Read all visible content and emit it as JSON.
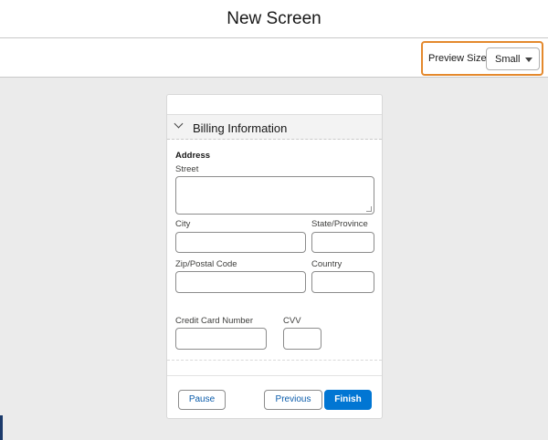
{
  "header": {
    "title": "New Screen"
  },
  "toolbar": {
    "preview_label": "Preview Size",
    "preview_size": "Small"
  },
  "section": {
    "title": "Billing Information",
    "address_heading": "Address",
    "labels": {
      "street": "Street",
      "city": "City",
      "state": "State/Province",
      "zip": "Zip/Postal Code",
      "country": "Country",
      "card_number": "Credit Card Number",
      "cvv": "CVV"
    }
  },
  "footer": {
    "pause": "Pause",
    "previous": "Previous",
    "finish": "Finish"
  },
  "colors": {
    "highlight": "#e4892d",
    "brand": "#0176d3",
    "link": "#0b5cab"
  }
}
